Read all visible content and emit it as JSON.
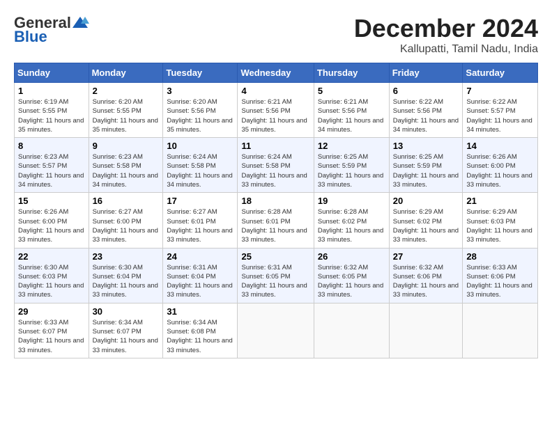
{
  "logo": {
    "general": "General",
    "blue": "Blue"
  },
  "title": {
    "month": "December 2024",
    "location": "Kallupatti, Tamil Nadu, India"
  },
  "headers": [
    "Sunday",
    "Monday",
    "Tuesday",
    "Wednesday",
    "Thursday",
    "Friday",
    "Saturday"
  ],
  "weeks": [
    [
      {
        "day": "1",
        "sunrise": "6:19 AM",
        "sunset": "5:55 PM",
        "daylight": "11 hours and 35 minutes."
      },
      {
        "day": "2",
        "sunrise": "6:20 AM",
        "sunset": "5:55 PM",
        "daylight": "11 hours and 35 minutes."
      },
      {
        "day": "3",
        "sunrise": "6:20 AM",
        "sunset": "5:56 PM",
        "daylight": "11 hours and 35 minutes."
      },
      {
        "day": "4",
        "sunrise": "6:21 AM",
        "sunset": "5:56 PM",
        "daylight": "11 hours and 35 minutes."
      },
      {
        "day": "5",
        "sunrise": "6:21 AM",
        "sunset": "5:56 PM",
        "daylight": "11 hours and 34 minutes."
      },
      {
        "day": "6",
        "sunrise": "6:22 AM",
        "sunset": "5:56 PM",
        "daylight": "11 hours and 34 minutes."
      },
      {
        "day": "7",
        "sunrise": "6:22 AM",
        "sunset": "5:57 PM",
        "daylight": "11 hours and 34 minutes."
      }
    ],
    [
      {
        "day": "8",
        "sunrise": "6:23 AM",
        "sunset": "5:57 PM",
        "daylight": "11 hours and 34 minutes."
      },
      {
        "day": "9",
        "sunrise": "6:23 AM",
        "sunset": "5:58 PM",
        "daylight": "11 hours and 34 minutes."
      },
      {
        "day": "10",
        "sunrise": "6:24 AM",
        "sunset": "5:58 PM",
        "daylight": "11 hours and 34 minutes."
      },
      {
        "day": "11",
        "sunrise": "6:24 AM",
        "sunset": "5:58 PM",
        "daylight": "11 hours and 33 minutes."
      },
      {
        "day": "12",
        "sunrise": "6:25 AM",
        "sunset": "5:59 PM",
        "daylight": "11 hours and 33 minutes."
      },
      {
        "day": "13",
        "sunrise": "6:25 AM",
        "sunset": "5:59 PM",
        "daylight": "11 hours and 33 minutes."
      },
      {
        "day": "14",
        "sunrise": "6:26 AM",
        "sunset": "6:00 PM",
        "daylight": "11 hours and 33 minutes."
      }
    ],
    [
      {
        "day": "15",
        "sunrise": "6:26 AM",
        "sunset": "6:00 PM",
        "daylight": "11 hours and 33 minutes."
      },
      {
        "day": "16",
        "sunrise": "6:27 AM",
        "sunset": "6:00 PM",
        "daylight": "11 hours and 33 minutes."
      },
      {
        "day": "17",
        "sunrise": "6:27 AM",
        "sunset": "6:01 PM",
        "daylight": "11 hours and 33 minutes."
      },
      {
        "day": "18",
        "sunrise": "6:28 AM",
        "sunset": "6:01 PM",
        "daylight": "11 hours and 33 minutes."
      },
      {
        "day": "19",
        "sunrise": "6:28 AM",
        "sunset": "6:02 PM",
        "daylight": "11 hours and 33 minutes."
      },
      {
        "day": "20",
        "sunrise": "6:29 AM",
        "sunset": "6:02 PM",
        "daylight": "11 hours and 33 minutes."
      },
      {
        "day": "21",
        "sunrise": "6:29 AM",
        "sunset": "6:03 PM",
        "daylight": "11 hours and 33 minutes."
      }
    ],
    [
      {
        "day": "22",
        "sunrise": "6:30 AM",
        "sunset": "6:03 PM",
        "daylight": "11 hours and 33 minutes."
      },
      {
        "day": "23",
        "sunrise": "6:30 AM",
        "sunset": "6:04 PM",
        "daylight": "11 hours and 33 minutes."
      },
      {
        "day": "24",
        "sunrise": "6:31 AM",
        "sunset": "6:04 PM",
        "daylight": "11 hours and 33 minutes."
      },
      {
        "day": "25",
        "sunrise": "6:31 AM",
        "sunset": "6:05 PM",
        "daylight": "11 hours and 33 minutes."
      },
      {
        "day": "26",
        "sunrise": "6:32 AM",
        "sunset": "6:05 PM",
        "daylight": "11 hours and 33 minutes."
      },
      {
        "day": "27",
        "sunrise": "6:32 AM",
        "sunset": "6:06 PM",
        "daylight": "11 hours and 33 minutes."
      },
      {
        "day": "28",
        "sunrise": "6:33 AM",
        "sunset": "6:06 PM",
        "daylight": "11 hours and 33 minutes."
      }
    ],
    [
      {
        "day": "29",
        "sunrise": "6:33 AM",
        "sunset": "6:07 PM",
        "daylight": "11 hours and 33 minutes."
      },
      {
        "day": "30",
        "sunrise": "6:34 AM",
        "sunset": "6:07 PM",
        "daylight": "11 hours and 33 minutes."
      },
      {
        "day": "31",
        "sunrise": "6:34 AM",
        "sunset": "6:08 PM",
        "daylight": "11 hours and 33 minutes."
      },
      null,
      null,
      null,
      null
    ]
  ]
}
